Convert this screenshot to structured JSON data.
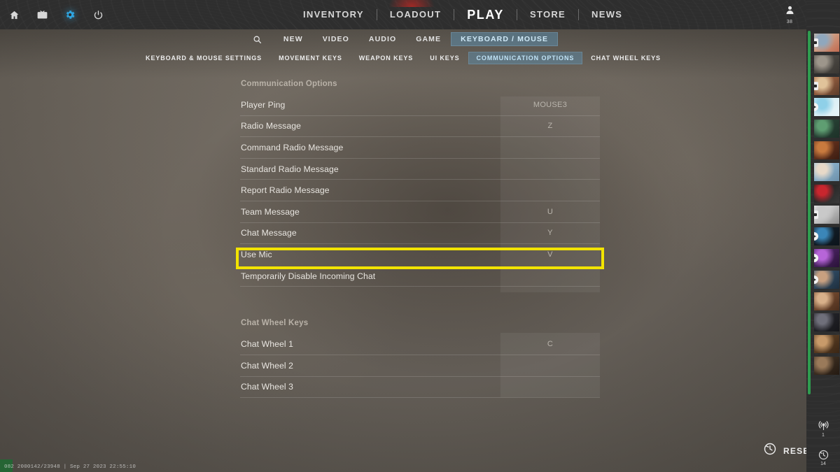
{
  "topbar": {
    "sysicons": [
      {
        "name": "home-icon",
        "label": "Home"
      },
      {
        "name": "tv-icon",
        "label": "Broadcast"
      },
      {
        "name": "gear-icon",
        "label": "Settings"
      },
      {
        "name": "power-icon",
        "label": "Quit"
      }
    ],
    "nav": [
      {
        "label": "INVENTORY",
        "active": false
      },
      {
        "label": "LOADOUT",
        "active": false
      },
      {
        "label": "PLAY",
        "active": true
      },
      {
        "label": "STORE",
        "active": false
      },
      {
        "label": "NEWS",
        "active": false
      }
    ],
    "profile": {
      "icon": "person-icon",
      "level": "38"
    }
  },
  "subnav": {
    "search_icon": "search-icon",
    "items": [
      {
        "label": "NEW",
        "active": false
      },
      {
        "label": "VIDEO",
        "active": false
      },
      {
        "label": "AUDIO",
        "active": false
      },
      {
        "label": "GAME",
        "active": false
      },
      {
        "label": "KEYBOARD / MOUSE",
        "active": true
      }
    ]
  },
  "tabs": [
    {
      "label": "KEYBOARD & MOUSE SETTINGS",
      "active": false
    },
    {
      "label": "MOVEMENT KEYS",
      "active": false
    },
    {
      "label": "WEAPON KEYS",
      "active": false
    },
    {
      "label": "UI KEYS",
      "active": false
    },
    {
      "label": "COMMUNICATION OPTIONS",
      "active": true
    },
    {
      "label": "CHAT WHEEL KEYS",
      "active": false
    }
  ],
  "settings": {
    "sections": [
      {
        "title": "Communication Options",
        "rows": [
          {
            "label": "Player Ping",
            "value": "MOUSE3",
            "highlight": false
          },
          {
            "label": "Radio Message",
            "value": "Z",
            "highlight": false
          },
          {
            "label": "Command Radio Message",
            "value": "",
            "highlight": false
          },
          {
            "label": "Standard Radio Message",
            "value": "",
            "highlight": false
          },
          {
            "label": "Report Radio Message",
            "value": "",
            "highlight": false
          },
          {
            "label": "Team Message",
            "value": "U",
            "highlight": false
          },
          {
            "label": "Chat Message",
            "value": "Y",
            "highlight": false
          },
          {
            "label": "Use Mic",
            "value": "V",
            "highlight": true
          },
          {
            "label": "Temporarily Disable Incoming Chat",
            "value": "",
            "highlight": false
          }
        ]
      },
      {
        "title": "Chat Wheel Keys",
        "rows": [
          {
            "label": "Chat Wheel 1",
            "value": "C",
            "highlight": false
          },
          {
            "label": "Chat Wheel 2",
            "value": "",
            "highlight": false
          },
          {
            "label": "Chat Wheel 3",
            "value": "",
            "highlight": false
          }
        ]
      }
    ]
  },
  "reset": {
    "label": "RESET",
    "icon": "history-restore-icon"
  },
  "status_line": "082 2000142/23948 | Sep 27 2023 22:55:10",
  "sidebar": {
    "scroll_indicator_color": "#2f9d4f",
    "friends": [
      {
        "name": "friend-avatar-1",
        "colors": [
          "#d9c3a8",
          "#8fa7bd",
          "#c06a50"
        ],
        "badge": "chat"
      },
      {
        "name": "friend-avatar-2",
        "colors": [
          "#58544e",
          "#9d968b",
          "#3a3733"
        ],
        "badge": ""
      },
      {
        "name": "friend-avatar-3",
        "colors": [
          "#b8724c",
          "#e0c39a",
          "#5a3b2a"
        ],
        "badge": "chat"
      },
      {
        "name": "friend-avatar-4",
        "colors": [
          "#cfe9f2",
          "#8fd0e8",
          "#e8f4f8"
        ],
        "badge": "play"
      },
      {
        "name": "friend-avatar-5",
        "colors": [
          "#2e4a3c",
          "#5f9e72",
          "#1d3128"
        ],
        "badge": ""
      },
      {
        "name": "friend-avatar-6",
        "colors": [
          "#7a3b22",
          "#c87a3e",
          "#3a1d12"
        ],
        "badge": ""
      },
      {
        "name": "friend-avatar-7",
        "colors": [
          "#9fc6e2",
          "#e8d9c8",
          "#6b8fa8"
        ],
        "badge": ""
      },
      {
        "name": "friend-avatar-8",
        "colors": [
          "#1a1a1a",
          "#c8262e",
          "#3a3a3a"
        ],
        "badge": ""
      },
      {
        "name": "friend-avatar-9",
        "colors": [
          "#f2f2f2",
          "#c9c9c9",
          "#8a8a8a"
        ],
        "badge": "chat"
      },
      {
        "name": "friend-avatar-10",
        "colors": [
          "#16232e",
          "#3b86b8",
          "#0c141b"
        ],
        "badge": "play"
      },
      {
        "name": "friend-avatar-11",
        "colors": [
          "#5b2a78",
          "#b765d8",
          "#2a1338"
        ],
        "badge": "play"
      },
      {
        "name": "friend-avatar-12",
        "colors": [
          "#3a5a78",
          "#c8a080",
          "#1e2f3e"
        ],
        "badge": "play"
      },
      {
        "name": "friend-avatar-13",
        "colors": [
          "#8a5a3a",
          "#d8b08a",
          "#4a2d1c"
        ],
        "badge": ""
      },
      {
        "name": "friend-avatar-14",
        "colors": [
          "#2a2a30",
          "#6f6f7a",
          "#16161a"
        ],
        "badge": ""
      },
      {
        "name": "friend-avatar-15",
        "colors": [
          "#6b4a2a",
          "#c89a6a",
          "#3a2615"
        ],
        "badge": ""
      },
      {
        "name": "friend-avatar-16",
        "colors": [
          "#4a3a2a",
          "#9a7a5a",
          "#241a12"
        ],
        "badge": ""
      }
    ],
    "bottom": [
      {
        "name": "broadcast-icon",
        "count": "1"
      },
      {
        "name": "history-icon",
        "count": "14"
      }
    ]
  }
}
